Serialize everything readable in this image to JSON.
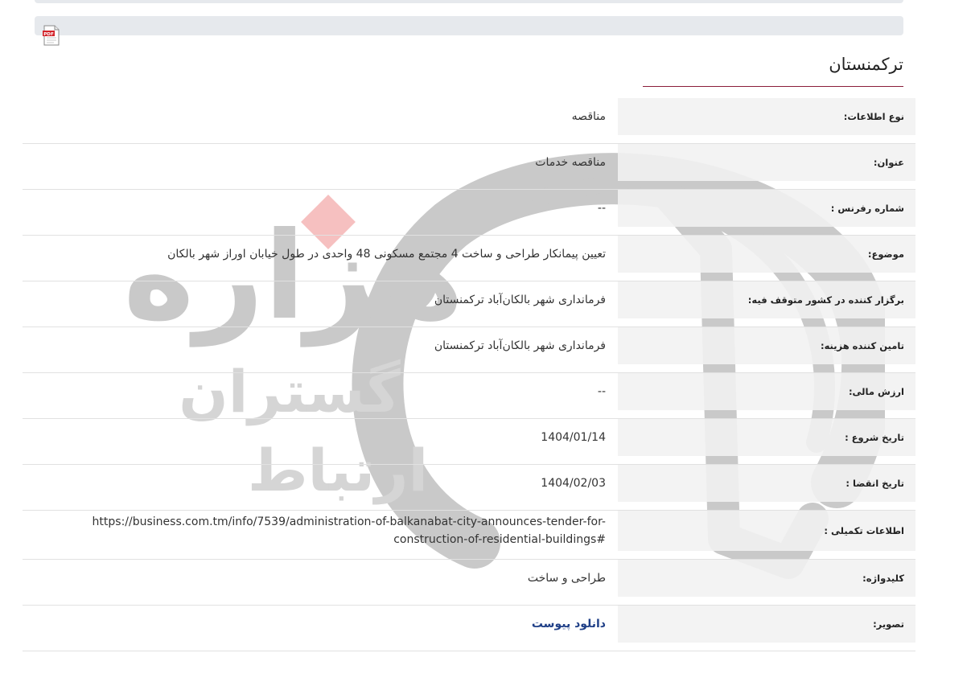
{
  "page": {
    "title": "ترکمنستان",
    "accent_color": "#8b1d3a",
    "pdf_icon": "pdf-icon",
    "pdf_badge": "PDF"
  },
  "watermark": {
    "brand_text": "هزاره",
    "sub_text_1": "گستران",
    "sub_text_2": "ارتباط"
  },
  "fields": [
    {
      "label": "نوع اطلاعات:",
      "value": "مناقصه"
    },
    {
      "label": "عنوان:",
      "value": "مناقصه خدمات"
    },
    {
      "label": "شماره رفرنس :",
      "value": "--"
    },
    {
      "label": "موضوع:",
      "value": "تعیین پیمانکار طراحی و ساخت 4 مجتمع مسکونی 48 واحدی در طول خیابان اوراز شهر بالکان"
    },
    {
      "label": "برگزار کننده در کشور متوقف فیه:",
      "value": "فرمانداری شهر بالکان‌آباد ترکمنستان"
    },
    {
      "label": "تامین کننده هزینه:",
      "value": "فرمانداری شهر بالکان‌آباد ترکمنستان"
    },
    {
      "label": "ارزش مالی:",
      "value": "--"
    },
    {
      "label": "تاریخ شروع :",
      "value": "1404/01/14"
    },
    {
      "label": "تاریخ انقضا :",
      "value": "1404/02/03"
    },
    {
      "label": "اطلاعات تکمیلی :",
      "value": "https://business.com.tm/info/7539/administration-of-balkanabat-city-announces-tender-for-construction-of-residential-buildings#"
    },
    {
      "label": "کلیدواژه:",
      "value": "طراحی و ساخت"
    },
    {
      "label": "تصویر:",
      "value": "دانلود پیوست"
    }
  ]
}
